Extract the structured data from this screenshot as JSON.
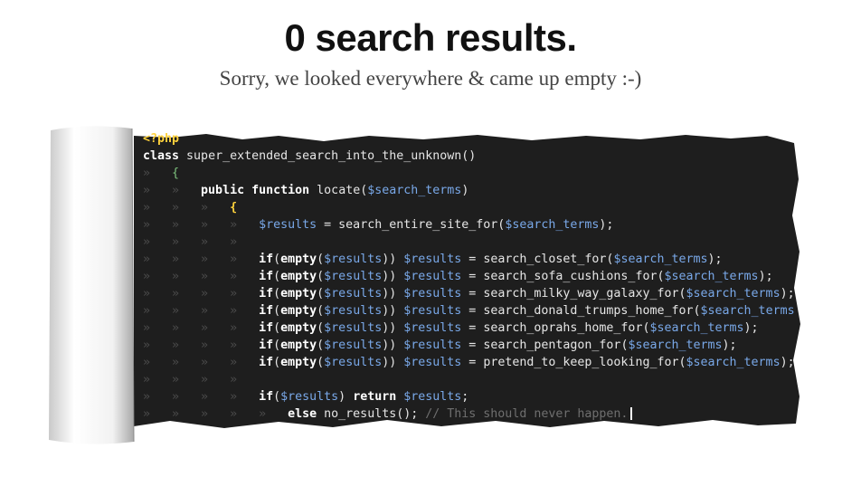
{
  "header": {
    "title": "0 search results.",
    "subtitle": "Sorry, we looked everywhere & came up empty :-)"
  },
  "code": {
    "l1": "<?php",
    "l2_kw": "class",
    "l2_name": "super_extended_search_into_the_unknown",
    "l2_paren": "()",
    "l3_brace": "{",
    "l4_kw1": "public",
    "l4_kw2": "function",
    "l4_name": "locate",
    "l4_var": "$search_terms",
    "l5_brace": "{",
    "l6_var": "$results",
    "l6_func": "search_entire_site_for",
    "l6_arg": "$search_terms",
    "checks": [
      {
        "func": "search_closet_for",
        "arg": "$search_terms",
        "end": ");"
      },
      {
        "func": "search_sofa_cushions_for",
        "arg": "$search_terms",
        "end": ");"
      },
      {
        "func": "search_milky_way_galaxy_for",
        "arg": "$search_terms",
        "end": ");"
      },
      {
        "func": "search_donald_trumps_home_for",
        "arg": "$search_terms",
        "end": ""
      },
      {
        "func": "search_oprahs_home_for",
        "arg": "$search_terms",
        "end": ");"
      },
      {
        "func": "search_pentagon_for",
        "arg": "$search_terms",
        "end": ");"
      },
      {
        "func": "pretend_to_keep_looking_for",
        "arg": "$search_terms",
        "end": ");"
      }
    ],
    "if_kw": "if",
    "empty_kw": "empty",
    "results_var": "$results",
    "return_kw": "return",
    "else_kw": "else",
    "no_results": "no_results",
    "comment": "// This should never happen."
  }
}
